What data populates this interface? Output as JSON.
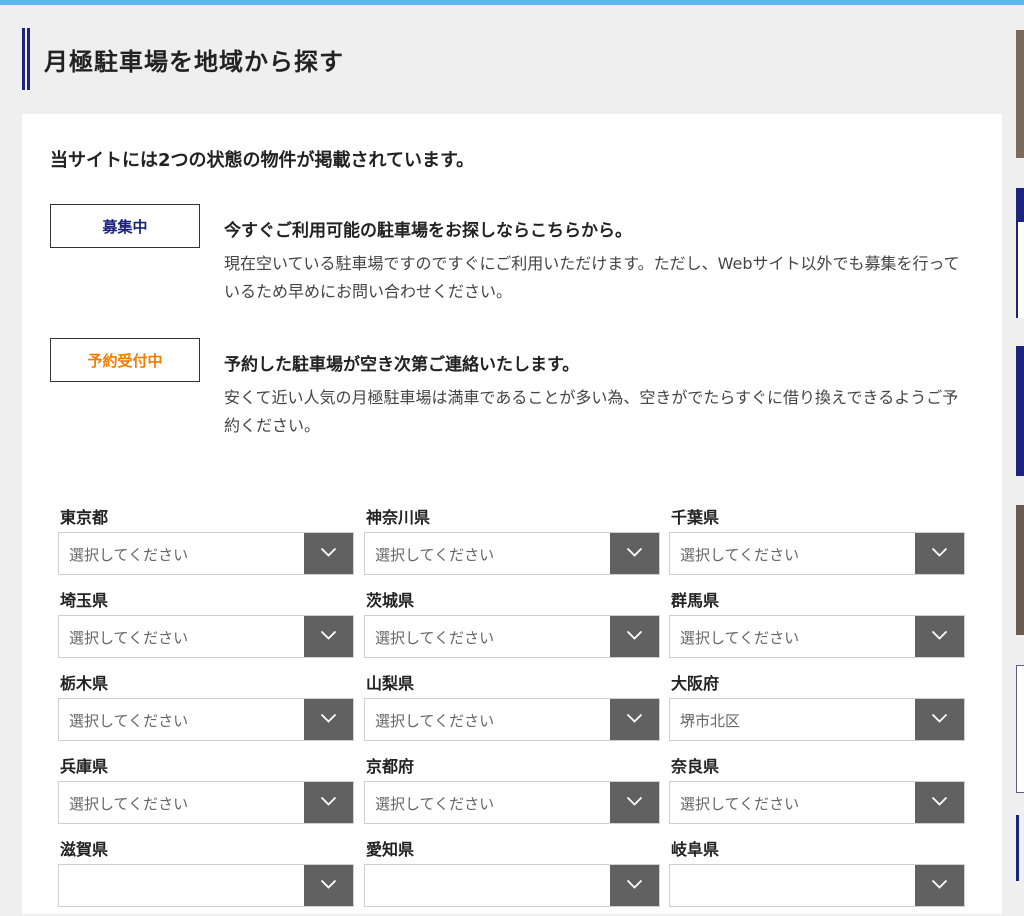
{
  "page": {
    "title": "月極駐車場を地域から探す",
    "intro": "当サイトには2つの状態の物件が掲載されています。"
  },
  "statuses": [
    {
      "badge": "募集中",
      "badge_color": "#1a237e",
      "heading": "今すぐご利用可能の駐車場をお探しならこちらから。",
      "description": "現在空いている駐車場ですのですぐにご利用いただけます。ただし、Webサイト以外でも募集を行っているため早めにお問い合わせください。"
    },
    {
      "badge": "予約受付中",
      "badge_color": "#f57c00",
      "heading": "予約した駐車場が空き次第ご連絡いたします。",
      "description": "安くて近い人気の月極駐車場は満車であることが多い為、空きがでたらすぐに借り換えできるようご予約ください。"
    }
  ],
  "prefectures": [
    {
      "name": "東京都",
      "selected": "選択してください"
    },
    {
      "name": "神奈川県",
      "selected": "選択してください"
    },
    {
      "name": "千葉県",
      "selected": "選択してください"
    },
    {
      "name": "埼玉県",
      "selected": "選択してください"
    },
    {
      "name": "茨城県",
      "selected": "選択してください"
    },
    {
      "name": "群馬県",
      "selected": "選択してください"
    },
    {
      "name": "栃木県",
      "selected": "選択してください"
    },
    {
      "name": "山梨県",
      "selected": "選択してください"
    },
    {
      "name": "大阪府",
      "selected": "堺市北区"
    },
    {
      "name": "兵庫県",
      "selected": "選択してください"
    },
    {
      "name": "京都府",
      "selected": "選択してください"
    },
    {
      "name": "奈良県",
      "selected": "選択してください"
    },
    {
      "name": "滋賀県",
      "selected": ""
    },
    {
      "name": "愛知県",
      "selected": ""
    },
    {
      "name": "岐阜県",
      "selected": ""
    }
  ],
  "colors": {
    "accent_navy": "#1a237e",
    "accent_orange": "#f57c00",
    "top_bar": "#5fb6ec",
    "select_button": "#616161"
  },
  "icons": {
    "select_arrow": "chevron-down-icon"
  }
}
